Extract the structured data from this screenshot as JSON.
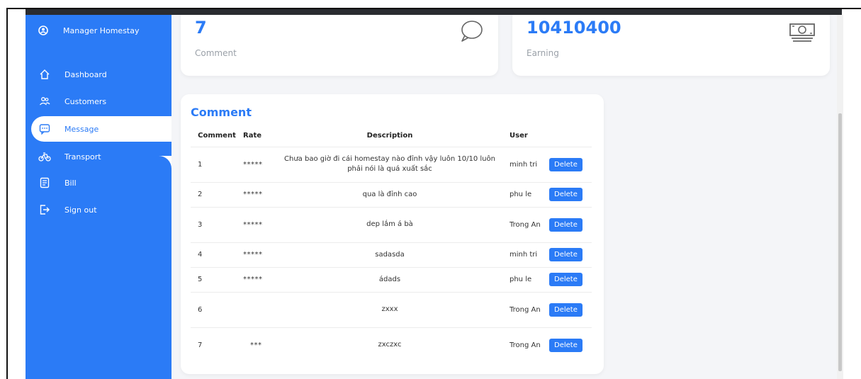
{
  "sidebar": {
    "brand": "Manager Homestay",
    "items": [
      {
        "label": "Dashboard",
        "icon": "home-icon"
      },
      {
        "label": "Customers",
        "icon": "users-icon"
      },
      {
        "label": "Message",
        "icon": "message-icon",
        "active": true
      },
      {
        "label": "Transport",
        "icon": "bike-icon"
      },
      {
        "label": "Bill",
        "icon": "bill-icon"
      },
      {
        "label": "Sign out",
        "icon": "sign-out-icon"
      }
    ]
  },
  "stats": {
    "comment": {
      "value": "7",
      "label": "Comment",
      "icon": "chat-bubble-icon"
    },
    "earning": {
      "value": "10410400",
      "label": "Earning",
      "icon": "money-icon"
    }
  },
  "comments": {
    "title": "Comment",
    "headers": [
      "Comment",
      "Rate",
      "Description",
      "User",
      ""
    ],
    "delete_label": "Delete",
    "rows": [
      {
        "id": "1",
        "rate": "*****",
        "description": "Chưa bao giờ đi cái homestay nào đỉnh vậy luôn 10/10 luôn phải nói là quá xuất sắc",
        "user": "minh tri"
      },
      {
        "id": "2",
        "rate": "*****",
        "description": "qua là đỉnh cao",
        "user": "phu le"
      },
      {
        "id": "3",
        "rate": "*****",
        "description": "dep lắm á bà",
        "user": "Trong An"
      },
      {
        "id": "4",
        "rate": "*****",
        "description": "sadasda",
        "user": "minh tri"
      },
      {
        "id": "5",
        "rate": "*****",
        "description": "ádads",
        "user": "phu le"
      },
      {
        "id": "6",
        "rate": "",
        "description": "zxxx",
        "user": "Trong An"
      },
      {
        "id": "7",
        "rate": "***",
        "description": "zxczxc",
        "user": "Trong An"
      }
    ]
  },
  "colors": {
    "accent": "#2b7bf6",
    "background": "#f4f5f8"
  }
}
